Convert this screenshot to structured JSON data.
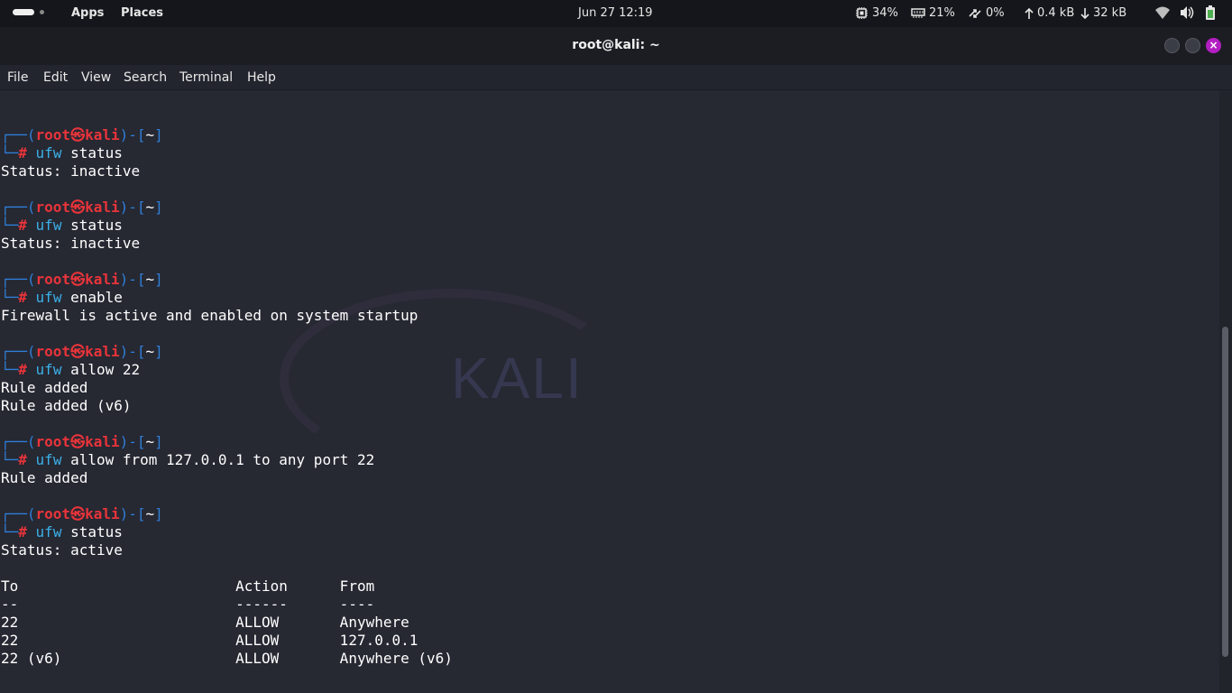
{
  "topbar": {
    "apps": "Apps",
    "places": "Places",
    "clock": "Jun 27  12:19",
    "cpu": "34%",
    "mem": "21%",
    "swap": "0%",
    "net_up": "0.4 kB",
    "net_down": "32 kB"
  },
  "window": {
    "title": "root@kali: ~"
  },
  "menubar": [
    "File",
    "Edit",
    "View",
    "Search",
    "Terminal",
    "Help"
  ],
  "terminal": {
    "user": "root",
    "host": "kali",
    "dir": "~",
    "blocks": [
      {
        "command": "ufw",
        "args": " status",
        "output": [
          "Status: inactive"
        ]
      },
      {
        "command": "ufw",
        "args": " status",
        "output": [
          "Status: inactive"
        ]
      },
      {
        "command": "ufw",
        "args": " enable",
        "output": [
          "Firewall is active and enabled on system startup"
        ]
      },
      {
        "command": "ufw",
        "args": " allow 22",
        "output": [
          "Rule added",
          "Rule added (v6)"
        ]
      },
      {
        "command": "ufw",
        "args": " allow from 127.0.0.1 to any port 22",
        "output": [
          "Rule added"
        ]
      },
      {
        "command": "ufw",
        "args": " status",
        "output": [
          "Status: active",
          "",
          "To                         Action      From",
          "--                         ------      ----",
          "22                         ALLOW       Anywhere",
          "22                         ALLOW       127.0.0.1",
          "22 (v6)                    ALLOW       Anywhere (v6)"
        ]
      }
    ],
    "watermark": "KALI"
  },
  "colors": {
    "prompt_frame": "#2f7fd8",
    "prompt_user": "#e8343a",
    "command": "#3bb0e8",
    "close_button": "#b31ec2"
  }
}
